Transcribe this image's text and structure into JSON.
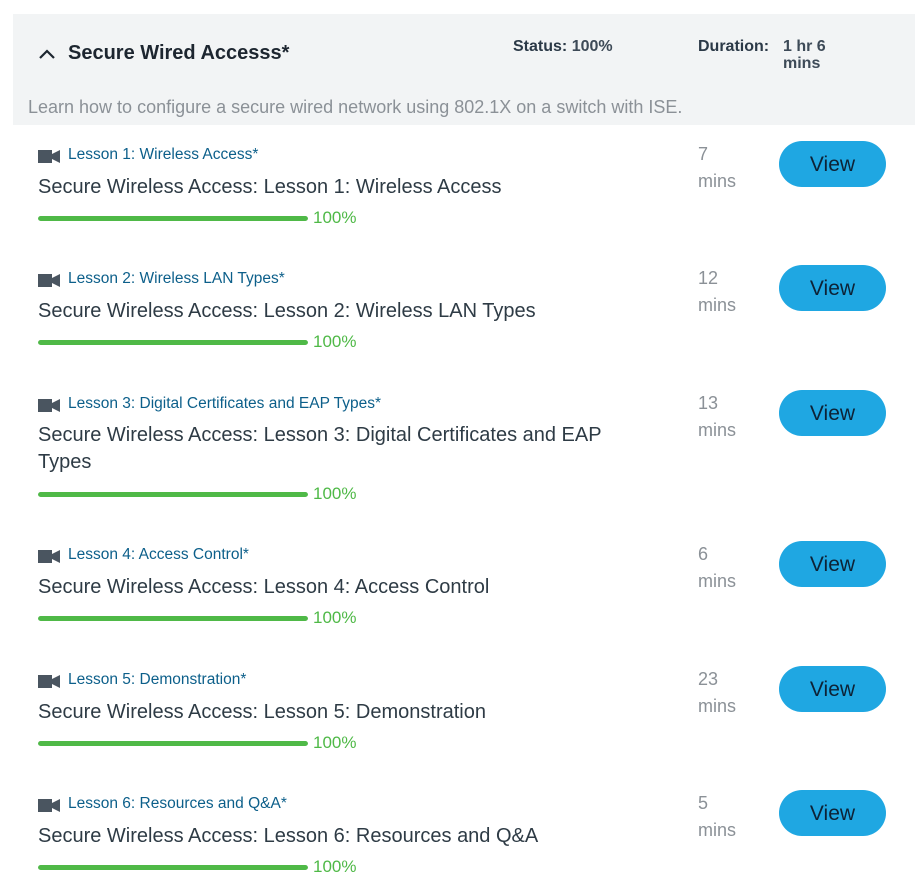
{
  "module": {
    "title": "Secure Wired Accesss*",
    "status_label": "Status:",
    "status_value": "100%",
    "duration_label": "Duration:",
    "duration_value": "1 hr 6 mins",
    "description": "Learn how to configure a secure wired network using 802.1X on a switch with ISE."
  },
  "view_label": "View",
  "icons": {
    "collapse": "chevron-up-icon",
    "lesson": "video-camera-icon"
  },
  "colors": {
    "accent": "#1fa7e2",
    "progress": "#4fb947",
    "link": "#0c5f8a"
  },
  "lessons": [
    {
      "link": "Lesson 1: Wireless Access*",
      "title": "Secure Wireless Access: Lesson 1: Wireless Access",
      "progress": 100,
      "progress_label": "100%",
      "duration_num": "7",
      "duration_unit": "mins"
    },
    {
      "link": "Lesson 2: Wireless LAN Types*",
      "title": "Secure Wireless Access: Lesson 2: Wireless LAN Types",
      "progress": 100,
      "progress_label": "100%",
      "duration_num": "12",
      "duration_unit": "mins"
    },
    {
      "link": "Lesson 3: Digital Certificates and EAP Types*",
      "title": "Secure Wireless Access: Lesson 3: Digital Certificates and EAP Types",
      "progress": 100,
      "progress_label": "100%",
      "duration_num": "13",
      "duration_unit": "mins"
    },
    {
      "link": "Lesson 4: Access Control*",
      "title": "Secure Wireless Access: Lesson 4: Access Control",
      "progress": 100,
      "progress_label": "100%",
      "duration_num": "6",
      "duration_unit": "mins"
    },
    {
      "link": "Lesson 5: Demonstration*",
      "title": "Secure Wireless Access: Lesson 5: Demonstration",
      "progress": 100,
      "progress_label": "100%",
      "duration_num": "23",
      "duration_unit": "mins"
    },
    {
      "link": "Lesson 6: Resources and Q&A*",
      "title": "Secure Wireless Access: Lesson 6: Resources and Q&A",
      "progress": 100,
      "progress_label": "100%",
      "duration_num": "5",
      "duration_unit": "mins"
    }
  ]
}
